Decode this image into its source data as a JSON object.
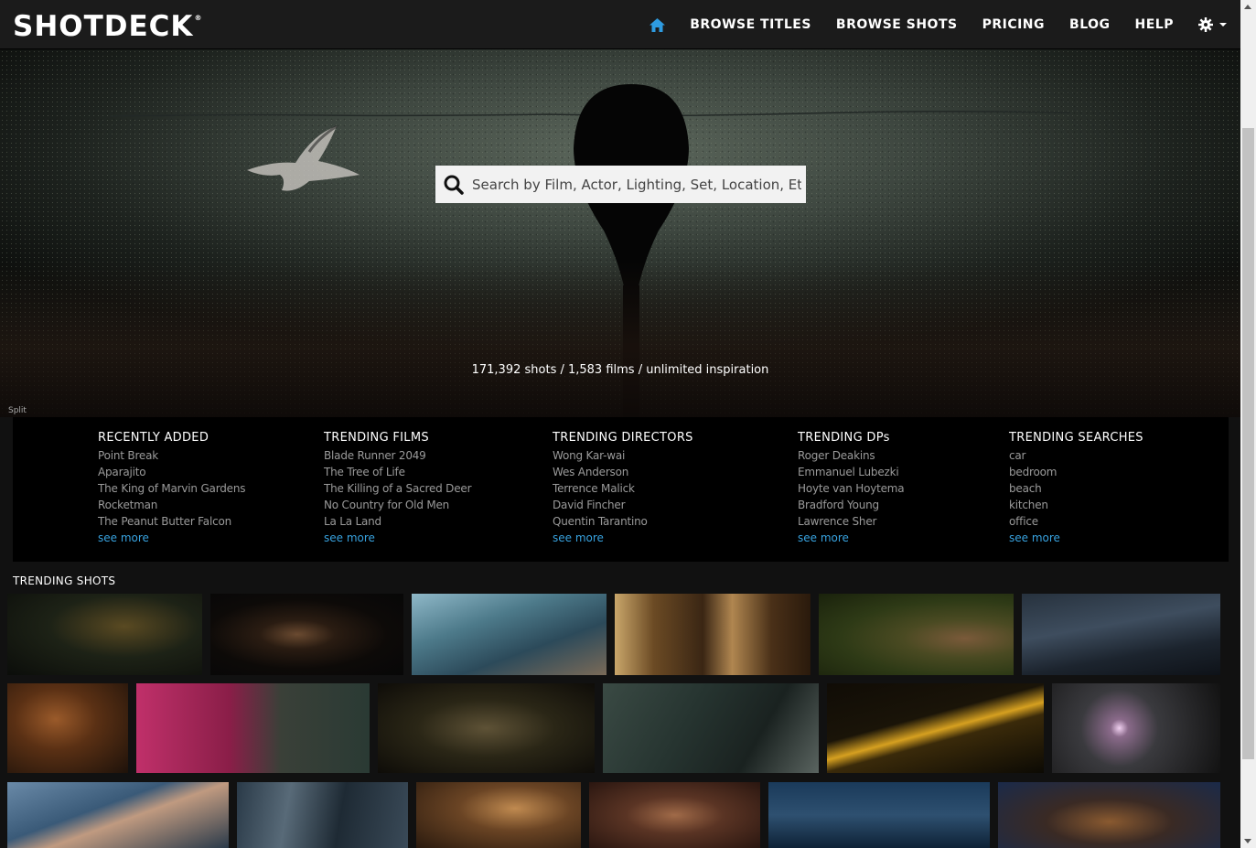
{
  "brand": {
    "logo_text": "SHOTDECK",
    "logo_mark": "®"
  },
  "nav": {
    "home_icon": "home-icon",
    "items": [
      "BROWSE TITLES",
      "BROWSE SHOTS",
      "PRICING",
      "BLOG",
      "HELP"
    ],
    "settings_icon": "gear-icon",
    "accent_color": "#2e9be0"
  },
  "hero": {
    "search_placeholder": "Search by Film, Actor, Lighting, Set, Location, Etc.",
    "stats": "171,392 shots / 1,583 films / unlimited inspiration",
    "credit": "Split"
  },
  "lists": [
    {
      "title": "RECENTLY ADDED",
      "items": [
        "Point Break",
        "Aparajito",
        "The King of Marvin Gardens",
        "Rocketman",
        "The Peanut Butter Falcon"
      ],
      "more": "see more"
    },
    {
      "title": "TRENDING FILMS",
      "items": [
        "Blade Runner 2049",
        "The Tree of Life",
        "The Killing of a Sacred Deer",
        "No Country for Old Men",
        "La La Land"
      ],
      "more": "see more"
    },
    {
      "title": "TRENDING DIRECTORS",
      "items": [
        "Wong Kar-wai",
        "Wes Anderson",
        "Terrence Malick",
        "David Fincher",
        "Quentin Tarantino"
      ],
      "more": "see more"
    },
    {
      "title": "TRENDING DPs",
      "items": [
        "Roger Deakins",
        "Emmanuel Lubezki",
        "Hoyte van Hoytema",
        "Bradford Young",
        "Lawrence Sher"
      ],
      "more": "see more"
    },
    {
      "title": "TRENDING SEARCHES",
      "items": [
        "car",
        "bedroom",
        "beach",
        "kitchen",
        "office"
      ],
      "more": "see more"
    }
  ],
  "trending_shots_title": "TRENDING SHOTS",
  "link_color": "#38a3e0"
}
